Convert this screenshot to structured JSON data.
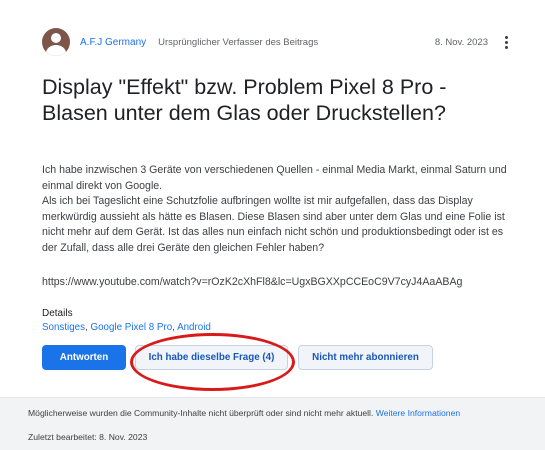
{
  "header": {
    "author": "A.F.J Germany",
    "author_role": "Ursprünglicher Verfasser des Beitrags",
    "date": "8. Nov. 2023",
    "menu_icon": "more-vert-icon"
  },
  "post": {
    "title": "Display \"Effekt\" bzw. Problem Pixel 8 Pro - Blasen unter dem Glas oder Druckstellen?",
    "paragraph1": "Ich habe inzwischen 3 Geräte von verschiedenen Quellen - einmal Media Markt, einmal Saturn und einmal direkt von Google.",
    "paragraph2": "Als ich bei Tageslicht eine Schutzfolie aufbringen wollte ist mir aufgefallen, dass das Display merkwürdig aussieht als hätte es Blasen. Diese Blasen sind aber unter dem Glas und eine Folie ist nicht mehr auf dem Gerät. Ist das alles nun einfach nicht schön und produktionsbedingt oder ist es der Zufall, dass alle drei Geräte den gleichen Fehler haben?",
    "url": "https://www.youtube.com/watch?v=rOzK2cXhFl8&lc=UgxBGXXpCCEoC9V7cyJ4AaABAg"
  },
  "details": {
    "label": "Details",
    "tags": [
      "Sonstiges",
      "Google Pixel 8 Pro",
      "Android"
    ],
    "separator": ", "
  },
  "actions": {
    "reply": "Antworten",
    "same_question": "Ich habe dieselbe Frage (4)",
    "unsubscribe": "Nicht mehr abonnieren"
  },
  "annotation": {
    "color": "#d91a1a",
    "shape": "ellipse"
  },
  "footer": {
    "note": "Möglicherweise wurden die Community-Inhalte nicht überprüft oder sind nicht mehr aktuell.",
    "more_info": "Weitere Informationen",
    "last_edited": "Zuletzt bearbeitet: 8. Nov. 2023"
  },
  "colors": {
    "accent": "#1a73e8",
    "avatar": "#7d5649",
    "footer_bg": "#f1f3f4"
  }
}
